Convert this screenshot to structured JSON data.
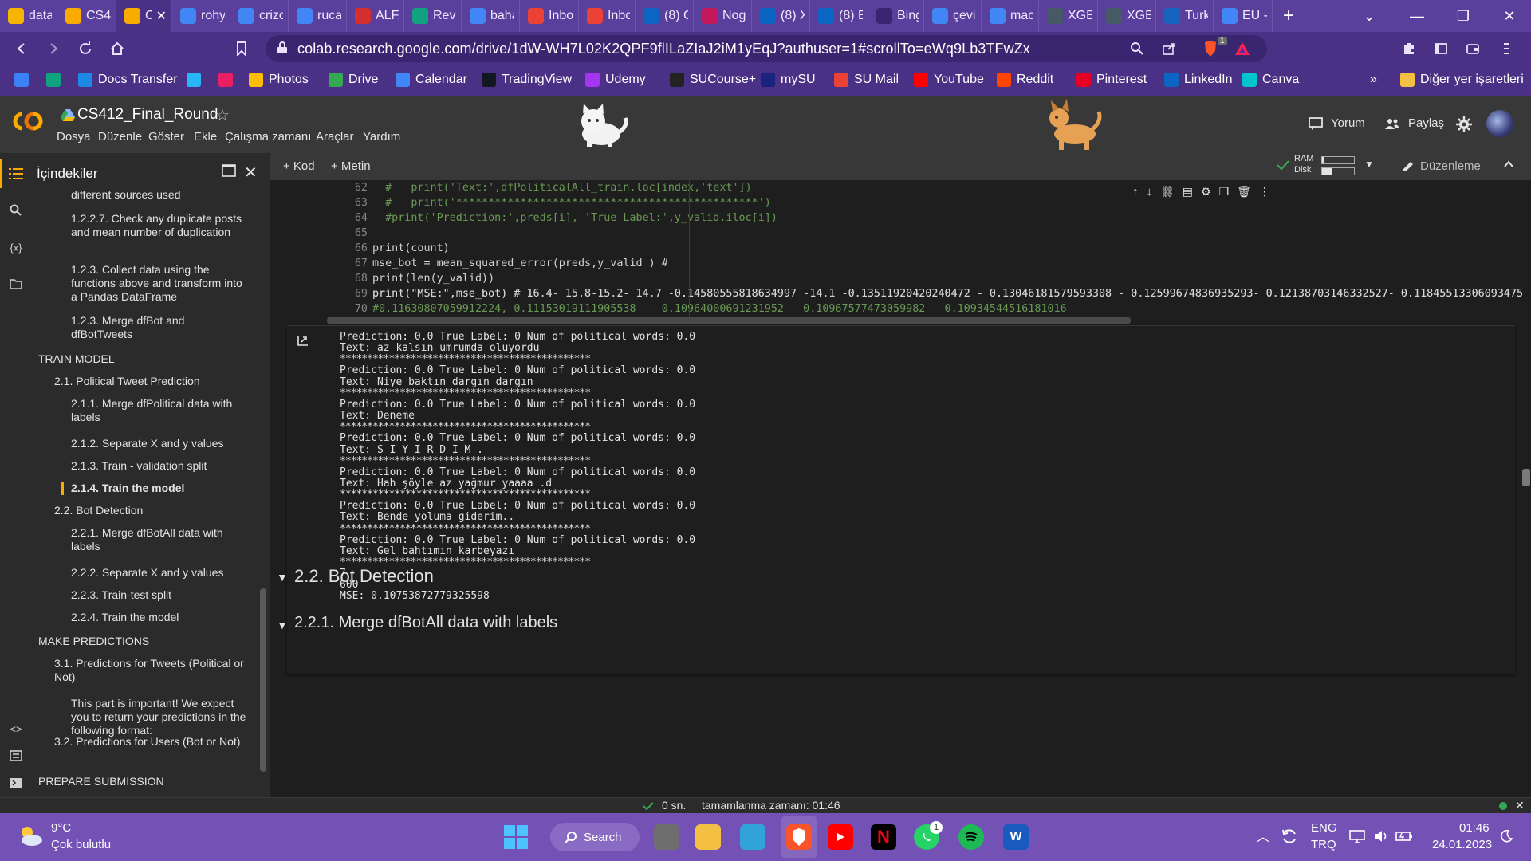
{
  "browser": {
    "tabs": [
      {
        "label": "data",
        "icon": "drive-icon",
        "color": "#f4b400"
      },
      {
        "label": "CS41",
        "icon": "colab-icon",
        "color": "#f9ab00"
      },
      {
        "label": "C",
        "icon": "colab-icon",
        "color": "#f9ab00",
        "active": true
      },
      {
        "label": "rohy",
        "icon": "google-icon",
        "color": "#4285f4"
      },
      {
        "label": "crizo",
        "icon": "google-icon",
        "color": "#4285f4"
      },
      {
        "label": "ruca",
        "icon": "google-icon",
        "color": "#4285f4"
      },
      {
        "label": "ALFA",
        "icon": "alfa-icon",
        "color": "#d32f2f"
      },
      {
        "label": "Revic",
        "icon": "review-icon",
        "color": "#10a37f"
      },
      {
        "label": "baha",
        "icon": "google-icon",
        "color": "#4285f4"
      },
      {
        "label": "Inbo",
        "icon": "gmail-icon",
        "color": "#ea4335"
      },
      {
        "label": "Inbo",
        "icon": "gmail-icon",
        "color": "#ea4335"
      },
      {
        "label": "(8) G",
        "icon": "linkedin-icon",
        "color": "#0a66c2"
      },
      {
        "label": "Nog",
        "icon": "podcast-icon",
        "color": "#c2185b"
      },
      {
        "label": "(8) X",
        "icon": "linkedin-icon",
        "color": "#0a66c2"
      },
      {
        "label": "(8) E",
        "icon": "linkedin-icon",
        "color": "#0a66c2"
      },
      {
        "label": "Bing",
        "icon": "search-icon",
        "color": "#3a2570"
      },
      {
        "label": "çevir",
        "icon": "google-icon",
        "color": "#4285f4"
      },
      {
        "label": "mac",
        "icon": "google-icon",
        "color": "#4285f4"
      },
      {
        "label": "XGB",
        "icon": "chart-icon",
        "color": "#455a64"
      },
      {
        "label": "XGB",
        "icon": "doc-icon",
        "color": "#455a64"
      },
      {
        "label": "Turk",
        "icon": "news24-icon",
        "color": "#1565c0"
      },
      {
        "label": "EU -",
        "icon": "google-icon",
        "color": "#4285f4"
      }
    ],
    "new_tab": "+",
    "url": "colab.research.google.com/drive/1dW-WH7L02K2QPF9flILaZIaJ2iM1yEqJ?authuser=1#scrollTo=eWq9Lb3TFwZx",
    "brave_badge": "1"
  },
  "bookmarks": [
    {
      "label": "",
      "icon": "bookmark-app-icon",
      "color": "#3b82f6"
    },
    {
      "label": "",
      "icon": "chatgpt-icon",
      "color": "#10a37f"
    },
    {
      "label": "Docs Transfer",
      "icon": "wifi-icon",
      "color": "#1e88e5"
    },
    {
      "label": "",
      "icon": "bar-chart-icon",
      "color": "#29b6f6"
    },
    {
      "label": "",
      "icon": "t-icon",
      "color": "#e91e63"
    },
    {
      "label": "Photos",
      "icon": "photos-icon",
      "color": "#fbbc04"
    },
    {
      "label": "Drive",
      "icon": "drive-icon",
      "color": "#34a853"
    },
    {
      "label": "Calendar",
      "icon": "calendar-icon",
      "color": "#4285f4"
    },
    {
      "label": "TradingView",
      "icon": "tradingview-icon",
      "color": "#131722"
    },
    {
      "label": "Udemy",
      "icon": "udemy-icon",
      "color": "#a435f0"
    },
    {
      "label": "SUCourse+",
      "icon": "sucourse-icon",
      "color": "#222222"
    },
    {
      "label": "mySU",
      "icon": "su-icon",
      "color": "#1a237e"
    },
    {
      "label": "SU Mail",
      "icon": "gmail-icon",
      "color": "#ea4335"
    },
    {
      "label": "YouTube",
      "icon": "youtube-icon",
      "color": "#ff0000"
    },
    {
      "label": "Reddit",
      "icon": "reddit-icon",
      "color": "#ff4500"
    },
    {
      "label": "Pinterest",
      "icon": "pinterest-icon",
      "color": "#e60023"
    },
    {
      "label": "LinkedIn",
      "icon": "linkedin-icon",
      "color": "#0a66c2"
    },
    {
      "label": "Canva",
      "icon": "canva-icon",
      "color": "#00c4cc"
    }
  ],
  "bookmarks_more": "»",
  "bookmarks_other": "Diğer yer işaretleri",
  "colab": {
    "title": "CS412_Final_Round",
    "menu": [
      "Dosya",
      "Düzenle",
      "Göster",
      "Ekle",
      "Çalışma zamanı",
      "Araçlar",
      "Yardım"
    ],
    "comment_label": "Yorum",
    "share_label": "Paylaş",
    "add_code": "+ Kod",
    "add_text": "+ Metin",
    "ram_label": "RAM",
    "disk_label": "Disk",
    "edit_mode": "Düzenleme"
  },
  "toc": {
    "heading": "İçindekiler",
    "items": [
      {
        "text": "different sources used",
        "level": 3
      },
      {
        "text": "1.2.2.7. Check any duplicate posts and mean number of duplication",
        "level": 3
      },
      {
        "text": "1.2.3. Collect data using the functions above and transform into a Pandas DataFrame",
        "level": 3
      },
      {
        "text": "1.2.3. Merge dfBot and dfBotTweets",
        "level": 3
      },
      {
        "text": "TRAIN MODEL",
        "level": 1
      },
      {
        "text": "2.1. Political Tweet Prediction",
        "level": 2
      },
      {
        "text": "2.1.1. Merge dfPolitical data with labels",
        "level": 3
      },
      {
        "text": "2.1.2. Separate X and y values",
        "level": 3
      },
      {
        "text": "2.1.3. Train - validation split",
        "level": 3
      },
      {
        "text": "2.1.4. Train the model",
        "level": 3,
        "active": true
      },
      {
        "text": "2.2. Bot Detection",
        "level": 2
      },
      {
        "text": "2.2.1. Merge dfBotAll data with labels",
        "level": 3
      },
      {
        "text": "2.2.2. Separate X and y values",
        "level": 3
      },
      {
        "text": "2.2.3. Train-test split",
        "level": 3
      },
      {
        "text": "2.2.4. Train the model",
        "level": 3
      },
      {
        "text": "MAKE PREDICTIONS",
        "level": 1
      },
      {
        "text": "3.1. Predictions for Tweets (Political or Not)",
        "level": 2
      },
      {
        "text": "This part is important! We expect you to return your predictions in the following format:",
        "level": 3
      },
      {
        "text": "3.2. Predictions for Users (Bot or Not)",
        "level": 2
      },
      {
        "text": "PREPARE SUBMISSION",
        "level": 1
      }
    ]
  },
  "code": {
    "lines": [
      {
        "n": "62",
        "text": "  #   print('Text:',dfPoliticalAll_train.loc[index,'text'])",
        "kind": "cmt"
      },
      {
        "n": "63",
        "text": "  #   print('***********************************************')",
        "kind": "cmt"
      },
      {
        "n": "64",
        "text": "  #print('Prediction:',preds[i], 'True Label:',y_valid.iloc[i])",
        "kind": "cmt"
      },
      {
        "n": "65",
        "text": "",
        "kind": "plain"
      },
      {
        "n": "66",
        "text": "print(count)",
        "kind": "plain"
      },
      {
        "n": "67",
        "text": "mse_bot = mean_squared_error(preds,y_valid ) #",
        "kind": "plain"
      },
      {
        "n": "68",
        "text": "print(len(y_valid))",
        "kind": "plain"
      },
      {
        "n": "69",
        "text": "print(\"MSE:\",mse_bot) # 16.4- 15.8-15.2- 14.7 -0.14580555818634997 -14.1 -0.13511920420240472 - 0.13046181579593308 - 0.12599674836935293- 0.12138703146332527- 0.11845513306093475 -0.1181",
        "kind": "mixed"
      },
      {
        "n": "70",
        "text": "#0.11630807059912224, 0.11153019111905538 -  0.10964000691231952 - 0.10967577473059982 - 0.10934544516181016",
        "kind": "cmt"
      }
    ]
  },
  "output": {
    "lines": [
      "Prediction: 0.0 True Label: 0 Num of political words: 0.0",
      "Text: az kalsın umrumda oluyordu",
      "**********************************************",
      "Prediction: 0.0 True Label: 0 Num of political words: 0.0",
      "Text: Niye baktın dargın dargın",
      "**********************************************",
      "Prediction: 0.0 True Label: 0 Num of political words: 0.0",
      "Text: Deneme",
      "**********************************************",
      "Prediction: 0.0 True Label: 0 Num of political words: 0.0",
      "Text: S I Y I R D I M .",
      "**********************************************",
      "Prediction: 0.0 True Label: 0 Num of political words: 0.0",
      "Text: Hah şöyle az yağmur yaaaa .d",
      "**********************************************",
      "Prediction: 0.0 True Label: 0 Num of political words: 0.0",
      "Text: Bende yoluma giderim..",
      "**********************************************",
      "Prediction: 0.0 True Label: 0 Num of political words: 0.0",
      "Text: Gel bahtımın karbeyazı",
      "**********************************************",
      "7",
      "600",
      "MSE: 0.10753872779325598"
    ]
  },
  "sections": {
    "h2": "2.2. Bot Detection",
    "h3": "2.2.1. Merge dfBotAll data with labels"
  },
  "status": {
    "elapsed": "0 sn.",
    "completed": "tamamlanma zamanı: 01:46"
  },
  "taskbar": {
    "weather_temp": "9°C",
    "weather_desc": "Çok bulutlu",
    "search": "Search",
    "lang_top": "ENG",
    "lang_bottom": "TRQ",
    "time": "01:46",
    "date": "24.01.2023",
    "whatsapp_badge": "1"
  }
}
